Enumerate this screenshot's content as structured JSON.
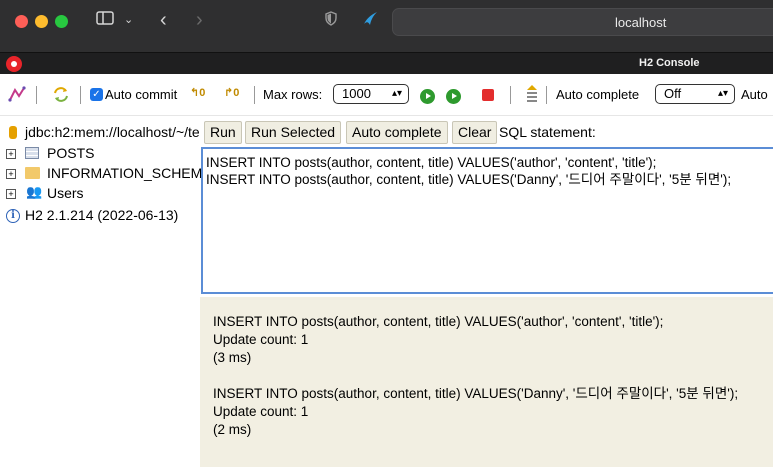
{
  "browser": {
    "url": "localhost",
    "tab_title": "H2 Console"
  },
  "toolbar": {
    "auto_commit_label": "Auto commit",
    "max_rows_label": "Max rows:",
    "max_rows_value": "1000",
    "auto_complete_label": "Auto complete",
    "auto_complete_value": "Off",
    "auto_select_label": "Auto"
  },
  "tree": {
    "connection": "jdbc:h2:mem://localhost/~/te",
    "items": [
      {
        "label": "POSTS"
      },
      {
        "label": "INFORMATION_SCHEM"
      },
      {
        "label": "Users"
      }
    ],
    "version": "H2 2.1.214 (2022-06-13)"
  },
  "buttons": {
    "run": "Run",
    "run_selected": "Run Selected",
    "auto_complete": "Auto complete",
    "clear": "Clear",
    "sql_statement_label": "SQL statement:"
  },
  "editor": {
    "lines": [
      "INSERT INTO posts(author, content, title) VALUES('author', 'content', 'title');",
      "INSERT INTO posts(author, content, title) VALUES('Danny', '드디어 주말이다', '5분 뒤면');"
    ]
  },
  "results": [
    {
      "statement": "INSERT INTO posts(author, content, title) VALUES('author', 'content', 'title');",
      "update_count": "Update count: 1",
      "time": "(3 ms)"
    },
    {
      "statement": "INSERT INTO posts(author, content, title) VALUES('Danny', '드디어 주말이다', '5분 뒤면');",
      "update_count": "Update count: 1",
      "time": "(2 ms)"
    }
  ],
  "colors": {
    "accent": "#1a73e8",
    "editor_border": "#5b8dd6",
    "results_bg": "#f2efe2"
  }
}
